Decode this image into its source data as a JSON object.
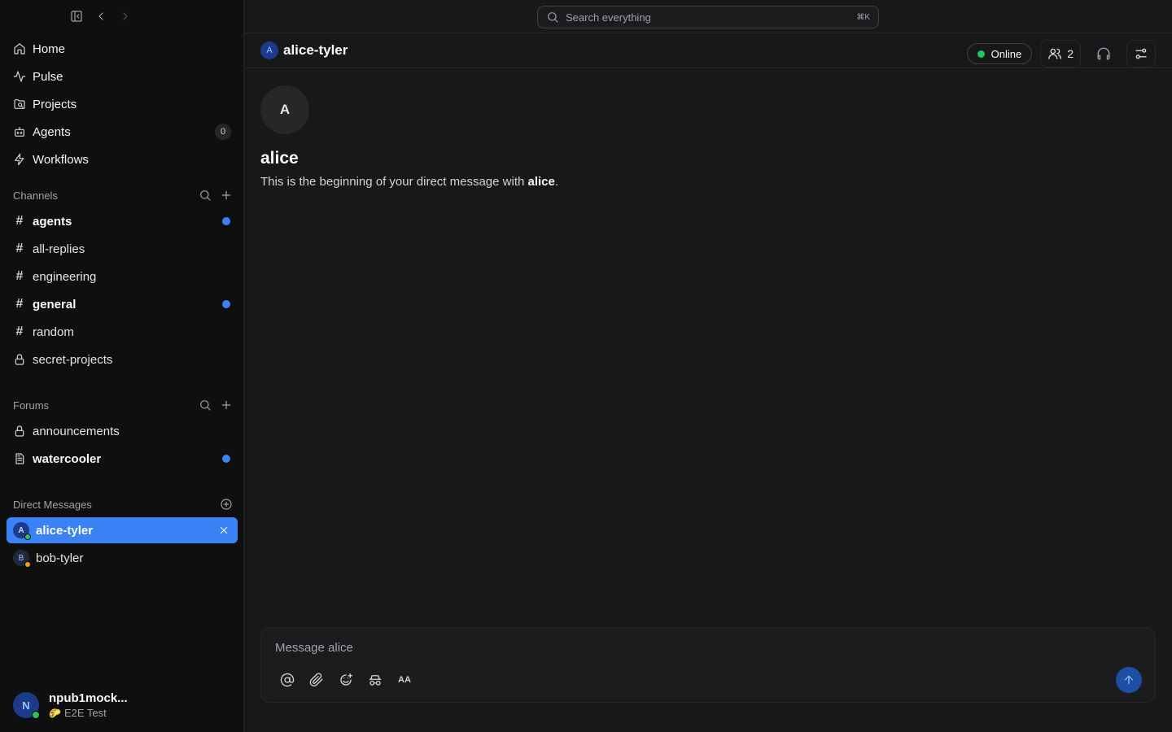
{
  "sidebar": {
    "nav": [
      {
        "label": "Home",
        "icon": "home-icon"
      },
      {
        "label": "Pulse",
        "icon": "pulse-icon"
      },
      {
        "label": "Projects",
        "icon": "projects-icon"
      },
      {
        "label": "Agents",
        "icon": "bot-icon",
        "count": "0"
      },
      {
        "label": "Workflows",
        "icon": "bolt-icon"
      }
    ],
    "channels_title": "Channels",
    "channels": [
      {
        "label": "agents",
        "unread": true
      },
      {
        "label": "all-replies",
        "unread": false
      },
      {
        "label": "engineering",
        "unread": false
      },
      {
        "label": "general",
        "unread": true
      },
      {
        "label": "random",
        "unread": false
      },
      {
        "label": "secret-projects",
        "unread": false,
        "icon": "lock-icon"
      }
    ],
    "forums_title": "Forums",
    "forums": [
      {
        "label": "announcements",
        "icon": "lock-icon",
        "unread": false
      },
      {
        "label": "watercooler",
        "icon": "document-icon",
        "unread": true
      }
    ],
    "dms_title": "Direct Messages",
    "dms": [
      {
        "label": "alice-tyler",
        "initial": "A",
        "presence": "online",
        "active": true
      },
      {
        "label": "bob-tyler",
        "initial": "B",
        "presence": "away",
        "active": false
      }
    ],
    "profile": {
      "initial": "N",
      "name": "npub1mock...",
      "status": "E2E Test"
    }
  },
  "search": {
    "placeholder": "Search everything",
    "shortcut": "⌘K"
  },
  "header": {
    "initial": "A",
    "title": "alice-tyler",
    "status": "Online",
    "members": "2"
  },
  "intro": {
    "initial": "A",
    "name": "alice",
    "text_prefix": "This is the beginning of your direct message with ",
    "text_name": "alice",
    "text_suffix": "."
  },
  "composer": {
    "placeholder": "Message alice",
    "format_label": "AA"
  },
  "colors": {
    "accent": "#3b82f6",
    "online": "#22c55e",
    "away": "#f59e0b"
  }
}
